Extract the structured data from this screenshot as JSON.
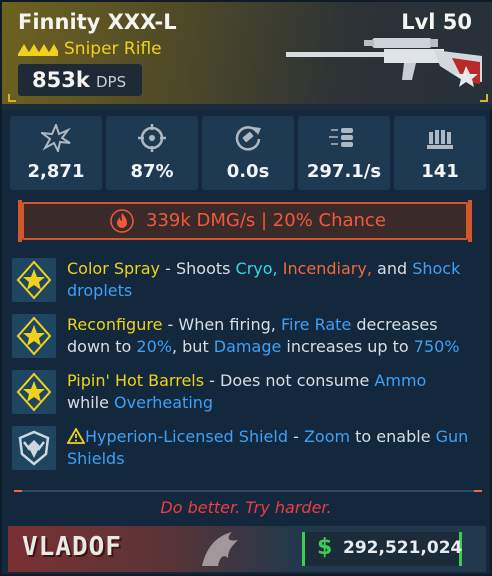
{
  "item": {
    "name": "Finnity XXX-L",
    "level": "Lvl 50",
    "type": "Sniper Rifle",
    "dps_value": "853k",
    "dps_label": "DPS"
  },
  "stats": [
    {
      "icon": "damage-burst-icon",
      "value": "2,871"
    },
    {
      "icon": "crosshair-icon",
      "value": "87%"
    },
    {
      "icon": "reload-icon",
      "value": "0.0s"
    },
    {
      "icon": "bullets-icon",
      "value": "297.1/s"
    },
    {
      "icon": "magazine-icon",
      "value": "141"
    }
  ],
  "element": {
    "icon": "fire-icon",
    "text": "339k DMG/s | 20% Chance"
  },
  "perks": [
    {
      "icon": "star-badge-icon",
      "name": "Color Spray",
      "sep": " - Shoots ",
      "t1": "Cryo,",
      "t2": "Incendiary,",
      "t3": " and ",
      "t4": "Shock",
      "t5": "droplets"
    },
    {
      "icon": "star-badge-icon",
      "name": "Reconfigure",
      "sep": " - When firing, ",
      "t1": "Fire Rate",
      "t2": " decreases",
      "t3": "down to ",
      "t4": "20%",
      "t5": ", but ",
      "t6": "Damage",
      "t7": " increases up to ",
      "t8": "750%"
    },
    {
      "icon": "star-badge-icon",
      "name": "Pipin' Hot Barrels",
      "sep": " - Does not consume ",
      "t1": "Ammo",
      "t2": "while ",
      "t3": "Overheating"
    },
    {
      "icon": "hyperion-shield-icon",
      "name": "Hyperion-Licensed Shield",
      "sep": " - ",
      "t1": "Zoom",
      "t2": " to enable ",
      "t3": "Gun",
      "t4": "Shields"
    }
  ],
  "flavor_text": "Do better. Try harder.",
  "footer": {
    "brand": "VLADOF",
    "currency_symbol": "$",
    "price": "292,521,024"
  },
  "colors": {
    "rarity": "#f0d21c",
    "cryo": "#35d7e6",
    "incendiary": "#f2683a",
    "blue_keyword": "#3ea0f6",
    "money": "#3fcc52"
  }
}
